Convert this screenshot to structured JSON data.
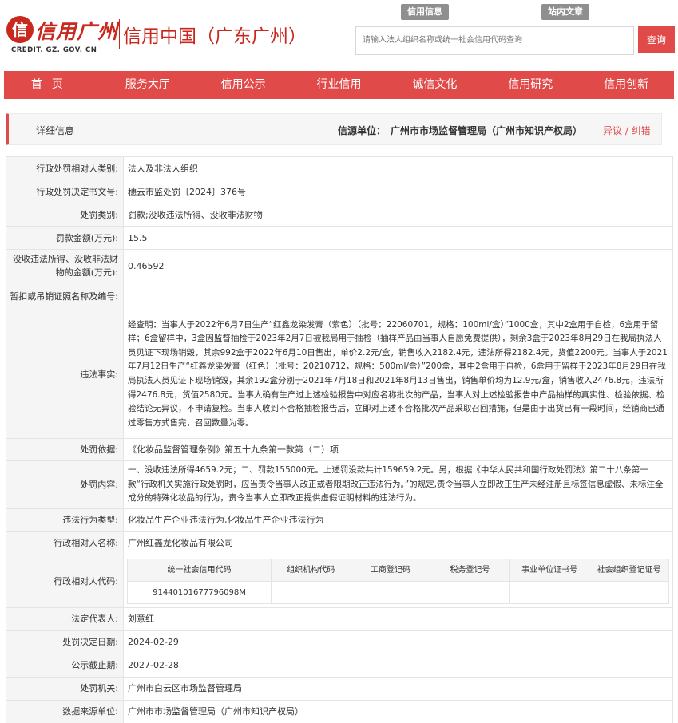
{
  "header": {
    "logo_seal": "信",
    "logo_cn": "信用广州",
    "logo_en": "CREDIT. GZ. GOV. CN",
    "site_title": "信用中国（广东广州）",
    "top_tabs": [
      "信用信息",
      "站内文章"
    ],
    "search_placeholder": "请输入法人组织名称或统一社会信用代码查询",
    "search_button": "查询"
  },
  "nav": [
    "首页",
    "服务大厅",
    "信用公示",
    "行业信用",
    "诚信文化",
    "信用研究",
    "信用创新"
  ],
  "detail": {
    "title": "详细信息",
    "source_label": "信源单位：",
    "source": "广州市市场监督管理局（广州市知识产权局）",
    "objection": "异议 / 纠错"
  },
  "rows": [
    {
      "label": "行政处罚相对人类别:",
      "value": "法人及非法人组织"
    },
    {
      "label": "行政处罚决定书文号:",
      "value": "穗云市监处罚〔2024〕376号"
    },
    {
      "label": "处罚类别:",
      "value": "罚款;没收违法所得、没收非法财物"
    },
    {
      "label": "罚款金额(万元):",
      "value": "15.5"
    },
    {
      "label": "没收违法所得、没收非法财物的金额(万元):",
      "value": "0.46592"
    },
    {
      "label": "暂扣或吊销证照名称及编号:",
      "value": ""
    },
    {
      "label": "违法事实:",
      "value": "经查明：当事人于2022年6月7日生产“红鑫龙染发膏（紫色）（批号：22060701，规格：100ml/盒）”1000盒，其中2盒用于自检，6盒用于留样；6盒留样中，3盒因监督抽检于2023年2月7日被我局用于抽检（抽样产品由当事人自愿免费提供），剩余3盒于2023年8月29日在我局执法人员见证下现场销毁，其余992盒于2022年6月10日售出，单价2.2元/盒，销售收入2182.4元，违法所得2182.4元，货值2200元。当事人于2021年7月12日生产“红鑫龙染发膏（红色）（批号：20210712，规格：500ml/盒）”200盒，其中2盒用于自检，6盒用于留样于2023年8月29日在我局执法人员见证下现场销毁，其余192盒分别于2021年7月18日和2021年8月13日售出，销售单价均为12.9元/盒，销售收入2476.8元，违法所得2476.8元，货值2580元。当事人确有生产过上述检验报告中对应名称批次的产品，当事人对上述检验报告中产品抽样的真实性、检验依据、检验结论无异议，不申请复检。当事人收到不合格抽检报告后，立即对上述不合格批次产品采取召回措施，但是由于出货已有一段时间，经销商已通过零售方式售完，召回数量为零。"
    },
    {
      "label": "处罚依据:",
      "value": "《化妆品监督管理条例》第五十九条第一款第（二）项"
    },
    {
      "label": "处罚内容:",
      "value": "一、没收违法所得4659.2元；二、罚款155000元。上述罚没款共计159659.2元。另，根据《中华人民共和国行政处罚法》第二十八条第一款“行政机关实施行政处罚时，应当责令当事人改正或者限期改正违法行为。”的规定,责令当事人立即改正生产未经注册且标签信息虚假、未标注全成分的特殊化妆品的行为，责令当事人立即改正提供虚假证明材料的违法行为。"
    },
    {
      "label": "违法行为类型:",
      "value": "化妆品生产企业违法行为,化妆品生产企业违法行为"
    },
    {
      "label": "行政相对人名称:",
      "value": "广州红鑫龙化妆品有限公司"
    }
  ],
  "codes": {
    "label": "行政相对人代码:",
    "headers": [
      "统一社会信用代码",
      "组织机构代码",
      "工商登记码",
      "税务登记号",
      "事业单位证书号",
      "社会组织登记证号"
    ],
    "values": [
      "91440101677796098M",
      "",
      "",
      "",
      "",
      ""
    ]
  },
  "rows2": [
    {
      "label": "法定代表人:",
      "value": "刘意红"
    },
    {
      "label": "处罚决定日期:",
      "value": "2024-02-29"
    },
    {
      "label": "公示截止期:",
      "value": "2027-02-28"
    },
    {
      "label": "处罚机关:",
      "value": "广州市白云区市场监督管理局"
    },
    {
      "label": "数据来源单位:",
      "value": "广州市市场监督管理局（广州市知识产权局）"
    }
  ]
}
